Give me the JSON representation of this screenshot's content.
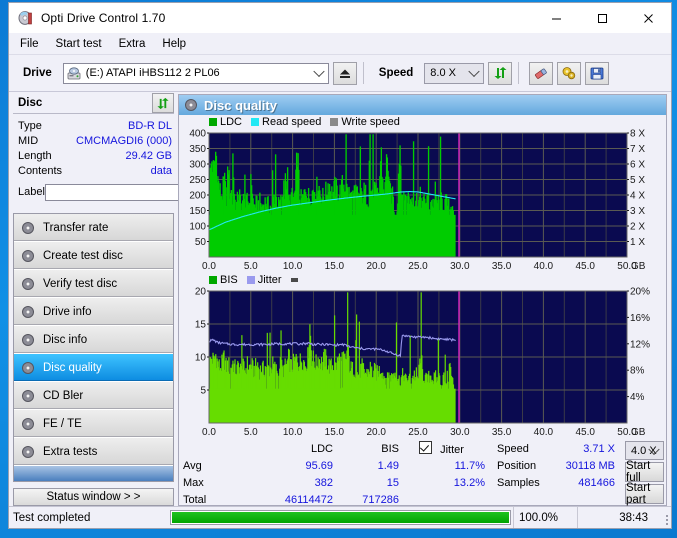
{
  "window": {
    "title": "Opti Drive Control 1.70",
    "app_icon": "disc-icon",
    "minimize": "—",
    "maximize": "□",
    "close": "✕"
  },
  "menu": {
    "items": [
      "File",
      "Start test",
      "Extra",
      "Help"
    ]
  },
  "toolbar": {
    "drive_label": "Drive",
    "drive_value": "(E:)   ATAPI iHBS112   2 PL06",
    "eject_icon": "eject-icon",
    "speed_label": "Speed",
    "speed_value": "8.0 X",
    "refresh_icon": "refresh-icon",
    "erase_icon": "eraser-icon",
    "settings_icon": "gears-icon",
    "save_icon": "floppy-save-icon"
  },
  "disc": {
    "header": "Disc",
    "refresh_icon": "refresh-icon",
    "rows": [
      {
        "key": "Type",
        "value": "BD-R DL"
      },
      {
        "key": "MID",
        "value": "CMCMAGDI6 (000)"
      },
      {
        "key": "Length",
        "value": "29.42 GB"
      },
      {
        "key": "Contents",
        "value": "data"
      }
    ],
    "label_key": "Label",
    "label_value": "",
    "label_placeholder": "",
    "label_button_icon": "disc-label-icon"
  },
  "nav": {
    "items": [
      {
        "label": "Transfer rate",
        "icon": "disc-transfer-icon",
        "selected": false
      },
      {
        "label": "Create test disc",
        "icon": "disc-burn-icon",
        "selected": false
      },
      {
        "label": "Verify test disc",
        "icon": "disc-verify-icon",
        "selected": false
      },
      {
        "label": "Drive info",
        "icon": "drive-info-icon",
        "selected": false
      },
      {
        "label": "Disc info",
        "icon": "disc-info-icon",
        "selected": false
      },
      {
        "label": "Disc quality",
        "icon": "disc-quality-icon",
        "selected": true
      },
      {
        "label": "CD Bler",
        "icon": "disc-bler-icon",
        "selected": false
      },
      {
        "label": "FE / TE",
        "icon": "disc-fete-icon",
        "selected": false
      },
      {
        "label": "Extra tests",
        "icon": "disc-extra-icon",
        "selected": false
      }
    ],
    "status_window_button": "Status window > >"
  },
  "panel": {
    "title": "Disc quality",
    "title_icon": "disc-quality-icon"
  },
  "chart_data": [
    {
      "id": "ldc-chart",
      "type": "area",
      "title": "",
      "xlabel": "GB",
      "ylabel": "",
      "y2label": "X",
      "xlim": [
        0,
        50
      ],
      "ylim": [
        0,
        400
      ],
      "y2lim": [
        0,
        8
      ],
      "xticks": [
        "0.0",
        "5.0",
        "10.0",
        "15.0",
        "20.0",
        "25.0",
        "30.0",
        "35.0",
        "40.0",
        "45.0",
        "50.0"
      ],
      "xtickvals": [
        0,
        5,
        10,
        15,
        20,
        25,
        30,
        35,
        40,
        45,
        50
      ],
      "yticks": [
        "50",
        "100",
        "150",
        "200",
        "250",
        "300",
        "350",
        "400"
      ],
      "ytickvals": [
        50,
        100,
        150,
        200,
        250,
        300,
        350,
        400
      ],
      "y2ticks": [
        "1 X",
        "2 X",
        "3 X",
        "4 X",
        "5 X",
        "6 X",
        "7 X",
        "8 X"
      ],
      "y2tickvals": [
        1,
        2,
        3,
        4,
        5,
        6,
        7,
        8
      ],
      "grid": true,
      "plot_bg": "#0a0a50",
      "legend_position": "top-left",
      "legend": [
        {
          "name": "LDC",
          "color": "#00cc00"
        },
        {
          "name": "Read speed",
          "color": "#22e8f4"
        },
        {
          "name": "Write speed",
          "color": "#8a8a8a"
        }
      ],
      "data_end_x": 29.5,
      "marker_x": 29.9,
      "marker_color": "#e020c8",
      "series": [
        {
          "name": "LDC",
          "kind": "area",
          "color": "#00cc00",
          "x": [
            0,
            0.25,
            0.5,
            0.75,
            1,
            1.25,
            1.5,
            1.75,
            2,
            2.25,
            2.5,
            2.75,
            3,
            3.25,
            3.5,
            3.75,
            4,
            4.25,
            4.5,
            4.75,
            5,
            5.25,
            5.5,
            5.75,
            6,
            6.25,
            6.5,
            6.75,
            7,
            7.25,
            7.5,
            7.75,
            8,
            8.25,
            8.5,
            8.75,
            9,
            9.25,
            9.5,
            9.75,
            10,
            10.25,
            10.5,
            10.75,
            11,
            11.25,
            11.5,
            11.75,
            12,
            12.25,
            12.5,
            12.75,
            13,
            13.25,
            13.5,
            13.75,
            14,
            14.25,
            14.5,
            14.75,
            15,
            15.25,
            15.5,
            15.75,
            16,
            16.25,
            16.5,
            16.75,
            17,
            17.25,
            17.5,
            17.75,
            18,
            18.25,
            18.5,
            18.75,
            19,
            19.25,
            19.5,
            19.75,
            20,
            20.25,
            20.5,
            20.75,
            21,
            21.25,
            21.5,
            21.75,
            22,
            22.25,
            22.5,
            22.75,
            23,
            23.25,
            23.5,
            23.75,
            24,
            24.25,
            24.5,
            24.75,
            25,
            25.25,
            25.5,
            25.75,
            26,
            26.25,
            26.5,
            26.75,
            27,
            27.25,
            27.5,
            27.75,
            28,
            28.25,
            28.5,
            28.75,
            29,
            29.25,
            29.5
          ],
          "y": [
            240,
            320,
            275,
            350,
            250,
            215,
            200,
            255,
            190,
            300,
            175,
            350,
            185,
            170,
            220,
            165,
            190,
            160,
            185,
            175,
            260,
            165,
            175,
            170,
            180,
            165,
            175,
            185,
            170,
            165,
            175,
            200,
            190,
            170,
            180,
            175,
            365,
            185,
            175,
            200,
            190,
            210,
            355,
            200,
            185,
            195,
            230,
            200,
            195,
            210,
            225,
            220,
            240,
            210,
            195,
            205,
            215,
            250,
            215,
            205,
            230,
            215,
            205,
            225,
            240,
            230,
            215,
            205,
            195,
            200,
            215,
            205,
            195,
            200,
            215,
            200,
            190,
            210,
            230,
            220,
            200,
            205,
            345,
            230,
            220,
            355,
            215,
            205,
            190,
            85,
            200,
            385,
            215,
            205,
            210,
            195,
            185,
            200,
            175,
            190,
            180,
            200,
            175,
            185,
            190,
            170,
            185,
            175,
            190,
            180,
            175,
            185,
            170,
            180,
            175,
            150,
            185,
            140
          ]
        },
        {
          "name": "Read speed",
          "kind": "line",
          "color": "#22e8f4",
          "axis": "y2",
          "x": [
            0,
            2,
            4,
            6,
            8,
            10,
            12,
            14,
            16,
            18,
            20,
            21,
            22,
            23,
            24,
            25,
            26,
            27,
            28,
            29,
            29.5
          ],
          "y": [
            1.75,
            2.25,
            2.6,
            2.9,
            3.15,
            3.35,
            3.5,
            3.65,
            3.78,
            3.9,
            4.0,
            4.05,
            4.12,
            4.2,
            4.22,
            4.2,
            4.1,
            4.0,
            3.9,
            3.8,
            3.75
          ]
        }
      ]
    },
    {
      "id": "bis-jitter-chart",
      "type": "area",
      "title": "",
      "xlabel": "GB",
      "ylabel": "",
      "y2label": "%",
      "xlim": [
        0,
        50
      ],
      "ylim": [
        0,
        20
      ],
      "y2lim": [
        0,
        20
      ],
      "xticks": [
        "0.0",
        "5.0",
        "10.0",
        "15.0",
        "20.0",
        "25.0",
        "30.0",
        "35.0",
        "40.0",
        "45.0",
        "50.0"
      ],
      "xtickvals": [
        0,
        5,
        10,
        15,
        20,
        25,
        30,
        35,
        40,
        45,
        50
      ],
      "yticks": [
        "5",
        "10",
        "15",
        "20"
      ],
      "ytickvals": [
        5,
        10,
        15,
        20
      ],
      "y2ticks": [
        "4%",
        "8%",
        "12%",
        "16%",
        "20%"
      ],
      "y2tickvals": [
        4,
        8,
        12,
        16,
        20
      ],
      "grid": true,
      "plot_bg": "#0a0a50",
      "legend_position": "top-left",
      "legend": [
        {
          "name": "BIS",
          "color": "#00cc00"
        },
        {
          "name": "Jitter",
          "color": "#9a9aee"
        }
      ],
      "data_end_x": 29.5,
      "marker_x": 29.9,
      "marker_color": "#e020c8",
      "series": [
        {
          "name": "BIS",
          "kind": "area",
          "color": "#66dd00",
          "x": [
            0,
            0.25,
            0.5,
            0.75,
            1,
            1.25,
            1.5,
            1.75,
            2,
            2.25,
            2.5,
            2.75,
            3,
            3.25,
            3.5,
            3.75,
            4,
            4.25,
            4.5,
            4.75,
            5,
            5.25,
            5.5,
            5.75,
            6,
            6.25,
            6.5,
            6.75,
            7,
            7.25,
            7.5,
            7.75,
            8,
            8.25,
            8.5,
            8.75,
            9,
            9.25,
            9.5,
            9.75,
            10,
            10.25,
            10.5,
            10.75,
            11,
            11.25,
            11.5,
            11.75,
            12,
            12.25,
            12.5,
            12.75,
            13,
            13.25,
            13.5,
            13.75,
            14,
            14.25,
            14.5,
            14.75,
            15,
            15.25,
            15.5,
            15.75,
            16,
            16.25,
            16.5,
            16.75,
            17,
            17.25,
            17.5,
            17.75,
            18,
            18.25,
            18.5,
            18.75,
            19,
            19.25,
            19.5,
            19.75,
            20,
            20.25,
            20.5,
            20.75,
            21,
            21.25,
            21.5,
            21.75,
            22,
            22.25,
            22.5,
            22.75,
            23,
            23.25,
            23.5,
            23.75,
            24,
            24.25,
            24.5,
            24.75,
            25,
            25.25,
            25.5,
            25.75,
            26,
            26.25,
            26.5,
            26.75,
            27,
            27.25,
            27.5,
            27.75,
            28,
            28.25,
            28.5,
            28.75,
            29,
            29.25,
            29.5
          ],
          "y": [
            9,
            10,
            9.5,
            10.5,
            9,
            8.5,
            9,
            10,
            8.5,
            9,
            8,
            9.5,
            8.5,
            8,
            9,
            8,
            8.5,
            8,
            9,
            8.5,
            9,
            8,
            8.5,
            9,
            8,
            8.5,
            8,
            9,
            8.5,
            8,
            9,
            8.5,
            8,
            8.5,
            9,
            8,
            8.5,
            9,
            10,
            8.5,
            9,
            9.5,
            10,
            9,
            10,
            9.5,
            9,
            10,
            15,
            10,
            9.5,
            9,
            10,
            9.5,
            9,
            10,
            9.5,
            9,
            8.5,
            9,
            8.5,
            9,
            10,
            9,
            10,
            9.5,
            11,
            9,
            8,
            8.5,
            8,
            7.5,
            8,
            8.5,
            8,
            7.5,
            8,
            8.5,
            7.5,
            8,
            7.5,
            8,
            8.5,
            7.5,
            7,
            7.5,
            8,
            7,
            7.5,
            8,
            7,
            6.5,
            7,
            7.5,
            6.5,
            7,
            6.5,
            7,
            7.5,
            6.5,
            7,
            11,
            7.5,
            7,
            6.5,
            7,
            7.5,
            6.5,
            7,
            6.5,
            7,
            6.5,
            7,
            6.5,
            7,
            9,
            6.5,
            6
          ]
        },
        {
          "name": "Jitter",
          "kind": "line",
          "color": "#9a9aee",
          "axis": "y2",
          "x": [
            0,
            0.5,
            1,
            2,
            3,
            4,
            5,
            6,
            7,
            8,
            9,
            10,
            11,
            11.9,
            12.5,
            13,
            14,
            15,
            16,
            17,
            18,
            19,
            20,
            21,
            22,
            22.9,
            23.1,
            24,
            25,
            26,
            27,
            28,
            29,
            29.5
          ],
          "y": [
            12.4,
            12.6,
            12.2,
            12.0,
            11.9,
            11.9,
            11.9,
            11.9,
            11.9,
            12.0,
            12.0,
            12.0,
            12.0,
            12.1,
            11.9,
            11.9,
            11.9,
            11.8,
            11.9,
            11.5,
            11.3,
            11.2,
            11.2,
            11.0,
            10.5,
            10.2,
            13.3,
            13.1,
            13.0,
            13.0,
            12.8,
            12.7,
            12.6,
            12.6
          ]
        }
      ]
    }
  ],
  "stats": {
    "col_headers": [
      "LDC",
      "BIS"
    ],
    "row_labels": [
      "Avg",
      "Max",
      "Total"
    ],
    "ldc": {
      "avg": "95.69",
      "max": "382",
      "total": "46114472"
    },
    "bis": {
      "avg": "1.49",
      "max": "15",
      "total": "717286"
    },
    "jitter": {
      "label": "Jitter",
      "checked": true,
      "avg": "11.7%",
      "max": "13.2%"
    },
    "speed": {
      "label": "Speed",
      "value": "3.71 X"
    },
    "position": {
      "label": "Position",
      "value": "30118 MB"
    },
    "samples": {
      "label": "Samples",
      "value": "481466"
    },
    "speed_select": "4.0 X",
    "start_full_button": "Start full",
    "start_part_button": "Start part"
  },
  "statusbar": {
    "message": "Test completed",
    "progress_pct": "100.0%",
    "progress_value": 100,
    "elapsed": "38:43"
  }
}
